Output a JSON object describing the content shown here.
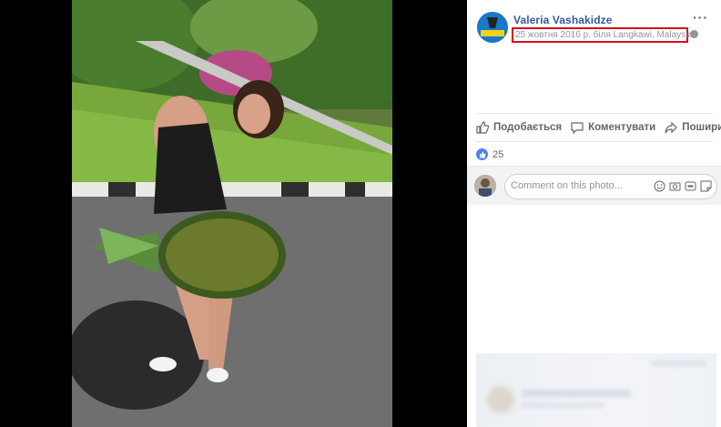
{
  "post": {
    "author": "Valeria Vashakidze",
    "meta": "25 жовтня 2016 р. біля Langkawi, Malaysia",
    "more": "···"
  },
  "actions": {
    "like": "Подобається",
    "comment": "Коментувати",
    "share": "Поширити"
  },
  "reactions": {
    "count": "25"
  },
  "comment_box": {
    "placeholder": "Comment on this photo..."
  },
  "colors": {
    "link": "#365899",
    "highlight_box": "#d4101c",
    "like_badge": "#4f83e6"
  },
  "icons": [
    "globe-icon",
    "more-icon",
    "like-icon",
    "comment-icon",
    "share-icon",
    "emoji-icon",
    "camera-icon",
    "gif-icon",
    "sticker-icon"
  ]
}
